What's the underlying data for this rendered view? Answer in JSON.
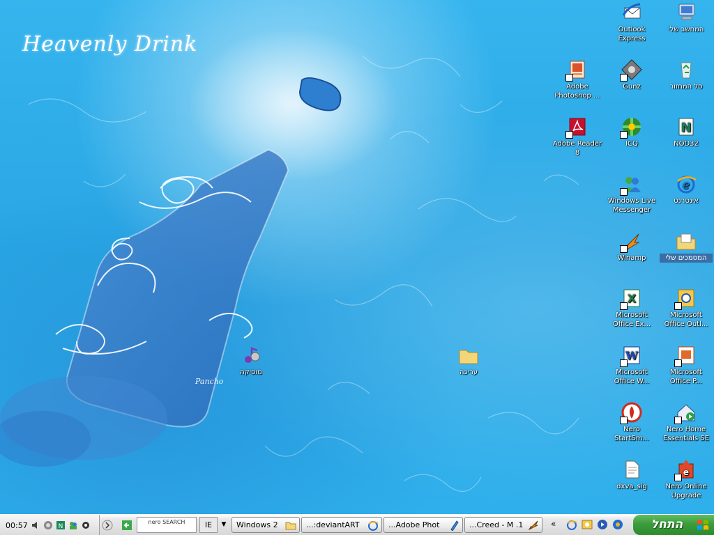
{
  "wallpaper": {
    "title": "Heavenly Drink",
    "signature": "Pancho"
  },
  "desktop_icons": [
    {
      "name": "my-computer-icon",
      "label": "המחשב שלי",
      "shortcut": false
    },
    {
      "name": "outlook-express-icon",
      "label": "Outlook Express",
      "shortcut": false
    },
    {
      "name": "recycle-bin-icon",
      "label": "סל המחזור",
      "shortcut": false
    },
    {
      "name": "gunz-icon",
      "label": "Gunz",
      "shortcut": true
    },
    {
      "name": "adobe-photoshop-icon",
      "label": "Adobe Photoshop ...",
      "shortcut": true
    },
    {
      "name": "nod32-icon",
      "label": "NOD32",
      "shortcut": true
    },
    {
      "name": "icq-icon",
      "label": "ICQ",
      "shortcut": true
    },
    {
      "name": "adobe-reader-icon",
      "label": "Adobe Reader 8",
      "shortcut": true
    },
    {
      "name": "internet-icon",
      "label": "אינטרנט",
      "shortcut": false
    },
    {
      "name": "windows-live-messenger-icon",
      "label": "Windows Live Messenger",
      "shortcut": true
    },
    {
      "name": "my-documents-icon",
      "label": "המסמכים שלי",
      "shortcut": false
    },
    {
      "name": "winamp-icon",
      "label": "Winamp",
      "shortcut": true
    },
    {
      "name": "ms-outlook-icon",
      "label": "Microsoft Office Outl...",
      "shortcut": true
    },
    {
      "name": "ms-excel-icon",
      "label": "Microsoft Office Ex...",
      "shortcut": true
    },
    {
      "name": "ms-powerpoint-icon",
      "label": "Microsoft Office P...",
      "shortcut": true
    },
    {
      "name": "ms-word-icon",
      "label": "Microsoft Office W...",
      "shortcut": true
    },
    {
      "name": "nero-home-icon",
      "label": "Nero Home Essentials SE",
      "shortcut": true
    },
    {
      "name": "nero-startsmart-icon",
      "label": "Nero StartSm...",
      "shortcut": true
    },
    {
      "name": "nero-online-upgrade-icon",
      "label": "Nero Online Upgrade",
      "shortcut": true
    },
    {
      "name": "dxva-sig-icon",
      "label": "dxva_sig",
      "shortcut": false
    },
    {
      "name": "music-icon",
      "label": "מוסיקה",
      "shortcut": false
    },
    {
      "name": "editing-folder-icon",
      "label": "עריכה",
      "shortcut": false
    }
  ],
  "taskbar": {
    "clock": "00:57",
    "start_label": "התחל",
    "nero_search_label": "nero SEARCH",
    "ie_label": "IE",
    "tasks": [
      {
        "label": "Windows 2",
        "icon": "folder-icon"
      },
      {
        "label": "...:deviantART",
        "icon": "ie-icon"
      },
      {
        "label": "...Adobe Phot",
        "icon": "photoshop-icon"
      },
      {
        "label": "...Creed - M .1",
        "icon": "winamp-icon"
      }
    ],
    "quick_launch_arrow": "«"
  },
  "colors": {
    "desktop_bg": "#2aa8e6",
    "start_green": "#3c9c3c",
    "selection": "#3a6ea5"
  }
}
